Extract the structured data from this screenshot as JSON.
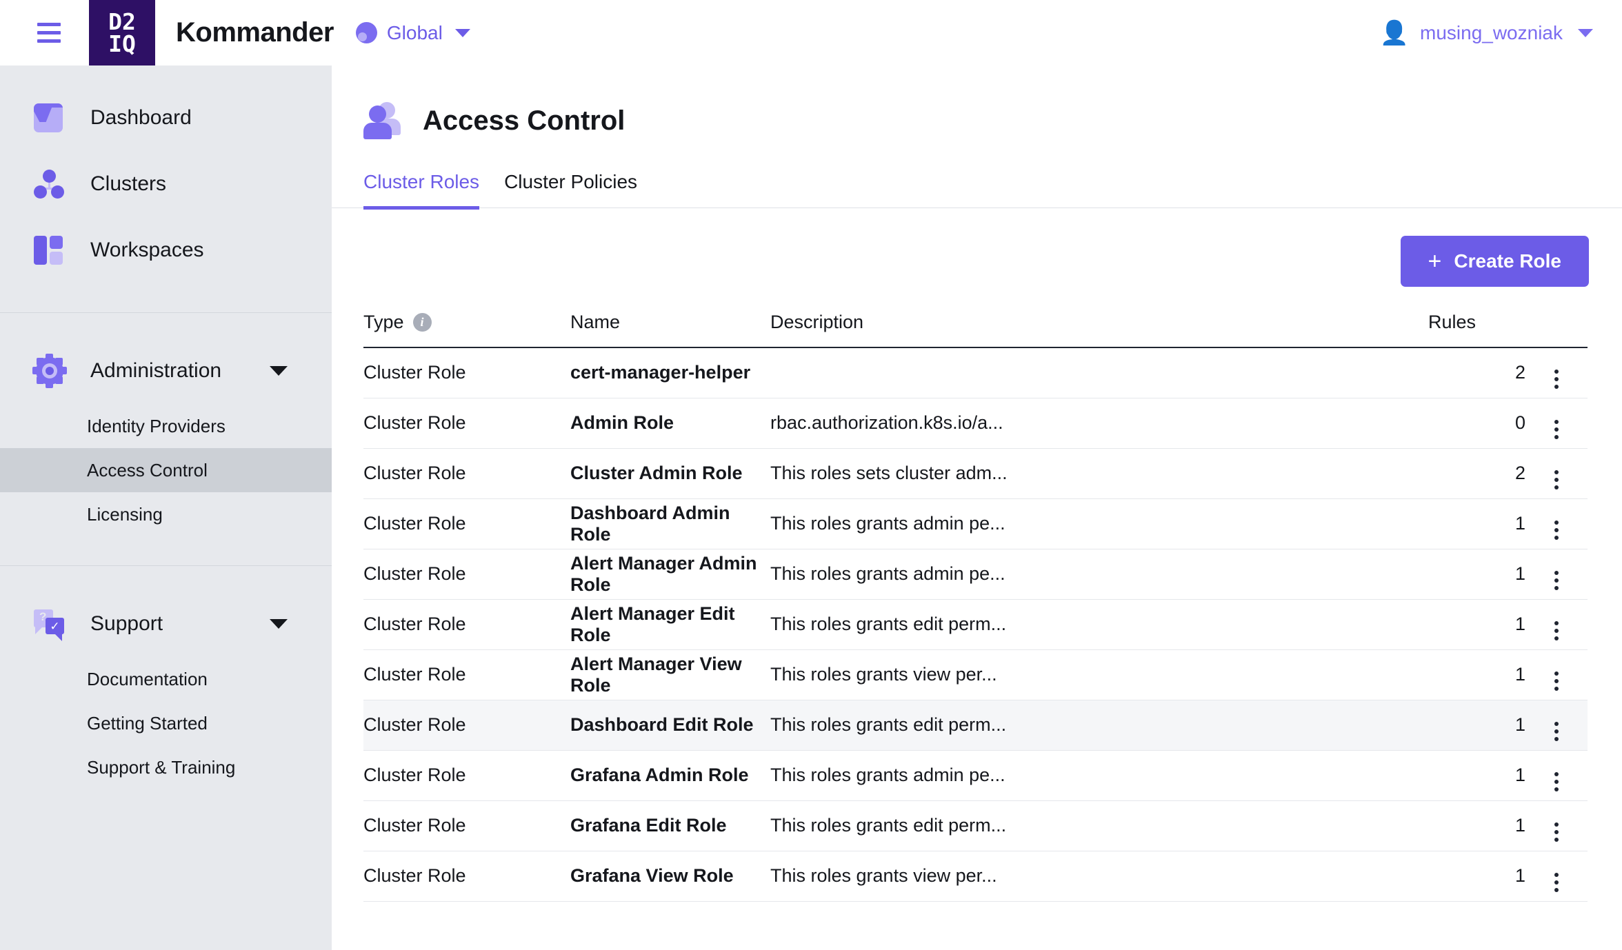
{
  "topbar": {
    "menu_icon": "hamburger-icon",
    "logo_line1": "D2",
    "logo_line2": "IQ",
    "brand": "Kommander",
    "scope_label": "Global",
    "user_name": "musing_wozniak"
  },
  "sidebar": {
    "primary": [
      {
        "label": "Dashboard",
        "icon": "dashboard-icon"
      },
      {
        "label": "Clusters",
        "icon": "clusters-icon"
      },
      {
        "label": "Workspaces",
        "icon": "workspaces-icon"
      }
    ],
    "administration": {
      "label": "Administration",
      "icon": "gear-icon",
      "items": [
        {
          "label": "Identity Providers",
          "active": false
        },
        {
          "label": "Access Control",
          "active": true
        },
        {
          "label": "Licensing",
          "active": false
        }
      ]
    },
    "support": {
      "label": "Support",
      "icon": "support-icon",
      "items": [
        {
          "label": "Documentation",
          "active": false
        },
        {
          "label": "Getting Started",
          "active": false
        },
        {
          "label": "Support & Training",
          "active": false
        }
      ]
    }
  },
  "main": {
    "page_title": "Access Control",
    "page_icon": "users-icon",
    "tabs": [
      {
        "label": "Cluster Roles",
        "active": true
      },
      {
        "label": "Cluster Policies",
        "active": false
      }
    ],
    "create_button": {
      "label": "Create Role",
      "plus": "+"
    },
    "table": {
      "headers": {
        "type": "Type",
        "name": "Name",
        "description": "Description",
        "rules": "Rules",
        "type_info_icon": "info-icon"
      },
      "rows": [
        {
          "type": "Cluster Role",
          "name": "cert-manager-helper",
          "description": "",
          "rules": "2",
          "hovered": false
        },
        {
          "type": "Cluster Role",
          "name": "Admin Role",
          "description": "rbac.authorization.k8s.io/a...",
          "rules": "0",
          "hovered": false
        },
        {
          "type": "Cluster Role",
          "name": "Cluster Admin Role",
          "description": "This roles sets cluster adm...",
          "rules": "2",
          "hovered": false
        },
        {
          "type": "Cluster Role",
          "name": "Dashboard Admin Role",
          "description": "This roles grants admin pe...",
          "rules": "1",
          "hovered": false
        },
        {
          "type": "Cluster Role",
          "name": "Alert Manager Admin Role",
          "description": "This roles grants admin pe...",
          "rules": "1",
          "hovered": false
        },
        {
          "type": "Cluster Role",
          "name": "Alert Manager Edit Role",
          "description": "This roles grants edit perm...",
          "rules": "1",
          "hovered": false
        },
        {
          "type": "Cluster Role",
          "name": "Alert Manager View Role",
          "description": "This roles grants view per...",
          "rules": "1",
          "hovered": false
        },
        {
          "type": "Cluster Role",
          "name": "Dashboard Edit Role",
          "description": "This roles grants edit perm...",
          "rules": "1",
          "hovered": true
        },
        {
          "type": "Cluster Role",
          "name": "Grafana Admin Role",
          "description": "This roles grants admin pe...",
          "rules": "1",
          "hovered": false
        },
        {
          "type": "Cluster Role",
          "name": "Grafana Edit Role",
          "description": "This roles grants edit perm...",
          "rules": "1",
          "hovered": false
        },
        {
          "type": "Cluster Role",
          "name": "Grafana View Role",
          "description": "This roles grants view per...",
          "rules": "1",
          "hovered": false
        }
      ]
    }
  },
  "colors": {
    "accent": "#6c5ce7",
    "accent_light": "#7b6cf0",
    "logo_bg": "#2e1065",
    "sidebar_bg": "#e7e9ed",
    "sidebar_active": "#ccd0d6",
    "text": "#15171c",
    "row_hover": "#f5f6f8"
  }
}
